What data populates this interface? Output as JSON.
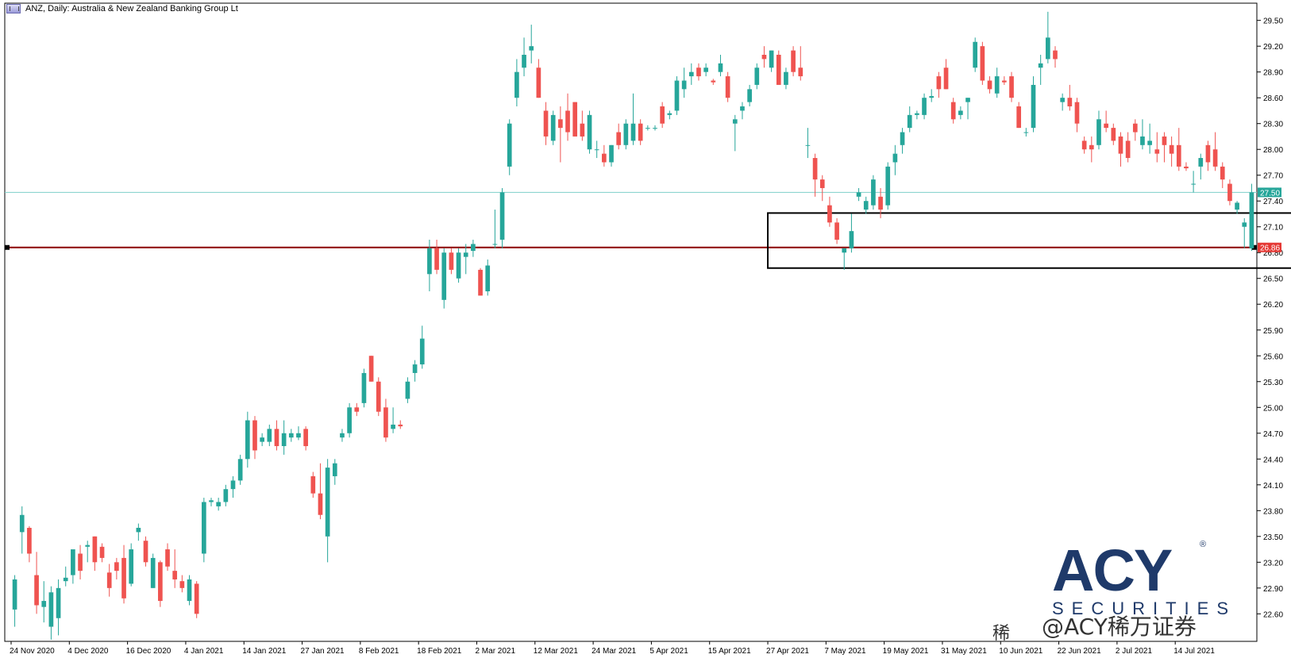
{
  "window": {
    "title": "ANZ, Daily:  Australia & New Zealand Banking Group Lt"
  },
  "logo": {
    "word": "ACY",
    "reg": "®",
    "sub": "SECURITIES"
  },
  "watermark": {
    "text": "@ACY稀万证券",
    "prefix": "稀"
  },
  "colors": {
    "up": "#26a69a",
    "down": "#ef5350",
    "support_line": "#8b0000",
    "resistance_line": "#7ecfc9",
    "box": "#000000",
    "axis": "#000000"
  },
  "chart_data": {
    "type": "candlestick",
    "y_ticks": [
      "29.50",
      "29.20",
      "28.90",
      "28.60",
      "28.30",
      "28.00",
      "27.70",
      "27.40",
      "27.10",
      "26.80",
      "26.50",
      "26.20",
      "25.90",
      "25.60",
      "25.30",
      "25.00",
      "24.70",
      "24.40",
      "24.10",
      "23.80",
      "23.50",
      "23.20",
      "22.90",
      "22.60"
    ],
    "ylim": [
      22.28,
      29.7
    ],
    "x_labels": [
      "24 Nov 2020",
      "4 Dec 2020",
      "16 Dec 2020",
      "4 Jan 2021",
      "14 Jan 2021",
      "27 Jan 2021",
      "8 Feb 2021",
      "18 Feb 2021",
      "2 Mar 2021",
      "12 Mar 2021",
      "24 Mar 2021",
      "5 Apr 2021",
      "15 Apr 2021",
      "27 Apr 2021",
      "7 May 2021",
      "19 May 2021",
      "31 May 2021",
      "10 Jun 2021",
      "22 Jun 2021",
      "2 Jul 2021",
      "14 Jul 2021"
    ],
    "label_every": 8,
    "levels": [
      {
        "name": "resistance",
        "value": 27.5,
        "label": "27.50"
      },
      {
        "name": "support",
        "value": 26.86,
        "label": "26.86"
      }
    ],
    "box": {
      "from_index": 104,
      "to_index": 176,
      "low": 26.62,
      "high": 27.26
    },
    "candles": [
      [
        22.65,
        23.05,
        22.45,
        23.0
      ],
      [
        23.55,
        23.85,
        23.3,
        23.75
      ],
      [
        23.6,
        23.62,
        23.2,
        23.3
      ],
      [
        23.05,
        23.32,
        22.6,
        22.7
      ],
      [
        22.68,
        22.98,
        22.5,
        22.75
      ],
      [
        22.45,
        22.92,
        22.3,
        22.85
      ],
      [
        22.55,
        23.0,
        22.35,
        22.9
      ],
      [
        22.98,
        23.15,
        22.92,
        23.02
      ],
      [
        23.05,
        23.25,
        22.95,
        23.35
      ],
      [
        23.3,
        23.4,
        23.0,
        23.1
      ],
      [
        23.38,
        23.45,
        23.2,
        23.4
      ],
      [
        23.5,
        23.5,
        23.1,
        23.2
      ],
      [
        23.38,
        23.42,
        23.2,
        23.25
      ],
      [
        23.08,
        23.18,
        22.8,
        22.9
      ],
      [
        23.2,
        23.25,
        23.0,
        23.1
      ],
      [
        23.25,
        23.4,
        22.72,
        22.78
      ],
      [
        22.95,
        23.42,
        22.92,
        23.35
      ],
      [
        23.55,
        23.65,
        23.45,
        23.6
      ],
      [
        23.45,
        23.5,
        23.15,
        23.2
      ],
      [
        22.9,
        23.3,
        22.9,
        23.25
      ],
      [
        23.2,
        23.22,
        22.68,
        22.75
      ],
      [
        23.35,
        23.42,
        23.1,
        23.15
      ],
      [
        23.1,
        23.35,
        22.9,
        23.0
      ],
      [
        22.98,
        23.05,
        22.85,
        22.9
      ],
      [
        22.75,
        23.05,
        22.7,
        23.0
      ],
      [
        22.95,
        22.98,
        22.55,
        22.6
      ],
      [
        23.3,
        23.95,
        23.2,
        23.9
      ],
      [
        23.9,
        23.95,
        23.85,
        23.92
      ],
      [
        23.85,
        23.95,
        23.8,
        23.9
      ],
      [
        23.9,
        24.1,
        23.85,
        24.05
      ],
      [
        24.05,
        24.2,
        23.95,
        24.15
      ],
      [
        24.15,
        24.45,
        24.1,
        24.4
      ],
      [
        24.4,
        24.95,
        24.3,
        24.85
      ],
      [
        24.85,
        24.9,
        24.4,
        24.5
      ],
      [
        24.6,
        24.7,
        24.55,
        24.65
      ],
      [
        24.6,
        24.8,
        24.55,
        24.75
      ],
      [
        24.75,
        24.85,
        24.5,
        24.55
      ],
      [
        24.55,
        24.85,
        24.45,
        24.7
      ],
      [
        24.65,
        24.75,
        24.6,
        24.7
      ],
      [
        24.65,
        24.78,
        24.62,
        24.7
      ],
      [
        24.75,
        24.78,
        24.5,
        24.55
      ],
      [
        24.2,
        24.25,
        23.95,
        24.0
      ],
      [
        24.0,
        24.35,
        23.7,
        23.75
      ],
      [
        23.5,
        24.4,
        23.2,
        24.3
      ],
      [
        24.2,
        24.4,
        24.1,
        24.35
      ],
      [
        24.65,
        24.75,
        24.6,
        24.7
      ],
      [
        24.7,
        25.05,
        24.65,
        25.0
      ],
      [
        25.0,
        25.05,
        24.9,
        24.95
      ],
      [
        25.05,
        25.45,
        25.0,
        25.4
      ],
      [
        25.6,
        25.6,
        25.3,
        25.3
      ],
      [
        25.3,
        25.35,
        24.9,
        24.95
      ],
      [
        25.0,
        25.1,
        24.6,
        24.65
      ],
      [
        24.75,
        25.0,
        24.7,
        24.8
      ],
      [
        24.8,
        24.85,
        24.75,
        24.78
      ],
      [
        25.1,
        25.35,
        25.05,
        25.3
      ],
      [
        25.4,
        25.55,
        25.3,
        25.5
      ],
      [
        25.5,
        25.95,
        25.45,
        25.8
      ],
      [
        26.55,
        26.95,
        26.35,
        26.85
      ],
      [
        26.85,
        26.95,
        26.55,
        26.6
      ],
      [
        26.25,
        26.85,
        26.15,
        26.8
      ],
      [
        26.8,
        26.85,
        26.55,
        26.6
      ],
      [
        26.5,
        26.85,
        26.45,
        26.8
      ],
      [
        26.75,
        26.9,
        26.55,
        26.8
      ],
      [
        26.82,
        26.95,
        26.75,
        26.9
      ],
      [
        26.6,
        26.62,
        26.3,
        26.3
      ],
      [
        26.35,
        26.72,
        26.3,
        26.65
      ],
      [
        26.9,
        27.3,
        26.85,
        26.9
      ],
      [
        26.95,
        27.55,
        26.85,
        27.5
      ],
      [
        27.8,
        28.35,
        27.7,
        28.3
      ],
      [
        28.6,
        29.05,
        28.5,
        28.9
      ],
      [
        28.95,
        29.3,
        28.85,
        29.1
      ],
      [
        29.15,
        29.45,
        29.0,
        29.2
      ],
      [
        28.95,
        29.05,
        28.6,
        28.6
      ],
      [
        28.45,
        28.55,
        28.05,
        28.15
      ],
      [
        28.1,
        28.45,
        28.05,
        28.4
      ],
      [
        28.35,
        28.5,
        27.85,
        28.25
      ],
      [
        28.45,
        28.65,
        28.1,
        28.2
      ],
      [
        28.55,
        28.55,
        28.15,
        28.15
      ],
      [
        28.3,
        28.45,
        28.1,
        28.15
      ],
      [
        28.0,
        28.45,
        27.95,
        28.4
      ],
      [
        28.0,
        28.1,
        27.9,
        28.0
      ],
      [
        27.95,
        28.05,
        27.8,
        27.85
      ],
      [
        27.85,
        28.05,
        27.8,
        28.05
      ],
      [
        28.2,
        28.3,
        28.0,
        28.05
      ],
      [
        28.05,
        28.35,
        28.0,
        28.3
      ],
      [
        28.1,
        28.65,
        28.05,
        28.3
      ],
      [
        28.3,
        28.35,
        28.05,
        28.1
      ],
      [
        28.25,
        28.28,
        28.22,
        28.25
      ],
      [
        28.25,
        28.28,
        28.22,
        28.25
      ],
      [
        28.5,
        28.55,
        28.25,
        28.3
      ],
      [
        28.4,
        28.45,
        28.35,
        28.42
      ],
      [
        28.45,
        28.85,
        28.4,
        28.8
      ],
      [
        28.7,
        28.95,
        28.6,
        28.8
      ],
      [
        28.85,
        29.0,
        28.75,
        28.9
      ],
      [
        28.95,
        29.0,
        28.8,
        28.85
      ],
      [
        28.9,
        29.0,
        28.85,
        28.95
      ],
      [
        28.8,
        28.82,
        28.75,
        28.78
      ],
      [
        28.9,
        29.1,
        28.85,
        29.0
      ],
      [
        28.85,
        28.9,
        28.55,
        28.6
      ],
      [
        28.3,
        28.4,
        27.98,
        28.35
      ],
      [
        28.45,
        28.55,
        28.35,
        28.5
      ],
      [
        28.55,
        28.75,
        28.5,
        28.7
      ],
      [
        28.75,
        29.0,
        28.7,
        28.95
      ],
      [
        29.1,
        29.2,
        28.95,
        29.05
      ],
      [
        28.95,
        29.15,
        28.9,
        29.15
      ],
      [
        29.1,
        29.15,
        28.75,
        28.75
      ],
      [
        28.75,
        28.95,
        28.7,
        28.9
      ],
      [
        29.15,
        29.2,
        28.85,
        28.9
      ],
      [
        28.95,
        29.2,
        28.8,
        28.85
      ],
      [
        28.05,
        28.25,
        27.9,
        28.05
      ],
      [
        27.9,
        27.95,
        27.45,
        27.65
      ],
      [
        27.65,
        27.7,
        27.4,
        27.55
      ],
      [
        27.35,
        27.45,
        27.1,
        27.15
      ],
      [
        27.15,
        27.2,
        26.9,
        26.95
      ],
      [
        26.8,
        26.85,
        26.6,
        26.85
      ],
      [
        26.85,
        27.25,
        26.8,
        27.05
      ],
      [
        27.45,
        27.55,
        27.4,
        27.5
      ],
      [
        27.3,
        27.45,
        27.25,
        27.4
      ],
      [
        27.35,
        27.7,
        27.3,
        27.65
      ],
      [
        27.45,
        27.55,
        27.2,
        27.3
      ],
      [
        27.35,
        27.85,
        27.3,
        27.8
      ],
      [
        27.85,
        28.05,
        27.7,
        27.95
      ],
      [
        28.05,
        28.25,
        27.95,
        28.2
      ],
      [
        28.25,
        28.5,
        28.2,
        28.4
      ],
      [
        28.4,
        28.45,
        28.35,
        28.42
      ],
      [
        28.4,
        28.65,
        28.35,
        28.6
      ],
      [
        28.6,
        28.7,
        28.55,
        28.62
      ],
      [
        28.85,
        28.9,
        28.6,
        28.7
      ],
      [
        28.95,
        29.05,
        28.7,
        28.7
      ],
      [
        28.55,
        28.6,
        28.3,
        28.35
      ],
      [
        28.4,
        28.5,
        28.35,
        28.45
      ],
      [
        28.55,
        28.6,
        28.35,
        28.6
      ],
      [
        28.95,
        29.3,
        28.9,
        29.25
      ],
      [
        29.2,
        29.25,
        28.75,
        28.8
      ],
      [
        28.8,
        28.85,
        28.65,
        28.7
      ],
      [
        28.65,
        28.95,
        28.6,
        28.85
      ],
      [
        28.8,
        28.85,
        28.75,
        28.78
      ],
      [
        28.85,
        28.9,
        28.55,
        28.6
      ],
      [
        28.5,
        28.55,
        28.25,
        28.25
      ],
      [
        28.2,
        28.25,
        28.15,
        28.2
      ],
      [
        28.25,
        28.85,
        28.2,
        28.75
      ],
      [
        28.95,
        29.1,
        28.75,
        29.0
      ],
      [
        29.05,
        29.6,
        29.0,
        29.3
      ],
      [
        29.15,
        29.2,
        28.95,
        29.05
      ],
      [
        28.55,
        28.65,
        28.45,
        28.6
      ],
      [
        28.6,
        28.75,
        28.45,
        28.5
      ],
      [
        28.55,
        28.6,
        28.2,
        28.3
      ],
      [
        28.1,
        28.15,
        27.95,
        28.0
      ],
      [
        28.05,
        28.15,
        27.85,
        28.0
      ],
      [
        28.05,
        28.45,
        28.0,
        28.35
      ],
      [
        28.3,
        28.45,
        28.2,
        28.25
      ],
      [
        28.25,
        28.3,
        28.05,
        28.1
      ],
      [
        28.15,
        28.2,
        27.8,
        27.95
      ],
      [
        28.1,
        28.2,
        27.85,
        27.9
      ],
      [
        28.3,
        28.35,
        28.1,
        28.2
      ],
      [
        28.05,
        28.35,
        28.0,
        28.15
      ],
      [
        28.05,
        28.3,
        27.95,
        28.1
      ],
      [
        28.0,
        28.2,
        27.85,
        27.95
      ],
      [
        28.15,
        28.2,
        27.85,
        28.05
      ],
      [
        28.05,
        28.15,
        27.8,
        27.95
      ],
      [
        28.05,
        28.25,
        27.75,
        27.8
      ],
      [
        27.8,
        27.85,
        27.75,
        27.78
      ],
      [
        27.6,
        27.75,
        27.5,
        27.6
      ],
      [
        27.8,
        27.95,
        27.65,
        27.9
      ],
      [
        28.05,
        28.1,
        27.75,
        27.85
      ],
      [
        28.0,
        28.2,
        27.75,
        27.8
      ],
      [
        27.8,
        27.85,
        27.55,
        27.65
      ],
      [
        27.6,
        27.65,
        27.35,
        27.4
      ],
      [
        27.3,
        27.4,
        27.25,
        27.38
      ],
      [
        27.1,
        27.2,
        26.85,
        27.15
      ],
      [
        26.85,
        27.6,
        26.82,
        27.5
      ]
    ]
  }
}
